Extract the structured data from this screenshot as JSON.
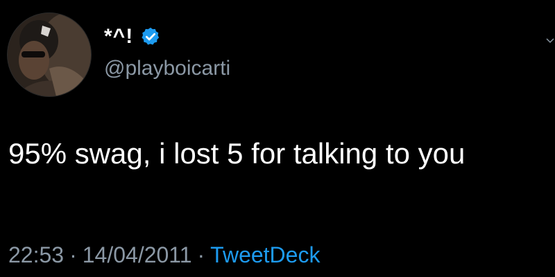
{
  "author": {
    "display_name": "*^!",
    "handle": "@playboicarti",
    "verified": true,
    "verified_icon": "verified-badge-icon",
    "avatar_icon": "profile-avatar"
  },
  "tweet": {
    "text": "95% swag, i lost 5 for talking to you"
  },
  "meta": {
    "time": "22:53",
    "date": "14/04/2011",
    "separator": "·",
    "source": "TweetDeck"
  },
  "colors": {
    "background": "#000000",
    "text": "#ffffff",
    "secondary": "#8b98a5",
    "accent": "#1d9bf0"
  }
}
